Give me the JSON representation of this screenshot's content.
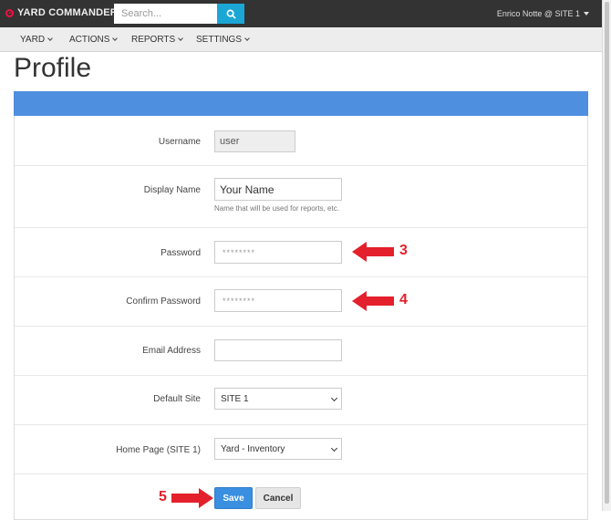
{
  "header": {
    "brand": "YARD COMMANDER",
    "search_placeholder": "Search...",
    "user_menu": "Enrico Notte @ SITE 1"
  },
  "nav": {
    "items": [
      {
        "label": "YARD"
      },
      {
        "label": "ACTIONS"
      },
      {
        "label": "REPORTS"
      },
      {
        "label": "SETTINGS"
      }
    ]
  },
  "page": {
    "title": "Profile"
  },
  "form": {
    "username": {
      "label": "Username",
      "value": "user"
    },
    "display_name": {
      "label": "Display Name",
      "value": "Your Name",
      "help": "Name that will be used for reports, etc."
    },
    "password": {
      "label": "Password",
      "value": "********"
    },
    "confirm_password": {
      "label": "Confirm Password",
      "value": "********"
    },
    "email": {
      "label": "Email Address",
      "value": ""
    },
    "default_site": {
      "label": "Default Site",
      "value": "SITE 1"
    },
    "home_page": {
      "label": "Home Page (SITE 1)",
      "value": "Yard - Inventory"
    },
    "save_label": "Save",
    "cancel_label": "Cancel"
  },
  "annotations": {
    "step_3": "3",
    "step_4": "4",
    "step_5": "5",
    "color": "#e3202b"
  },
  "colors": {
    "topbar": "#333333",
    "accent": "#1ba7d6",
    "panel_header": "#4f8fe0",
    "save_button": "#3a8fe0"
  }
}
